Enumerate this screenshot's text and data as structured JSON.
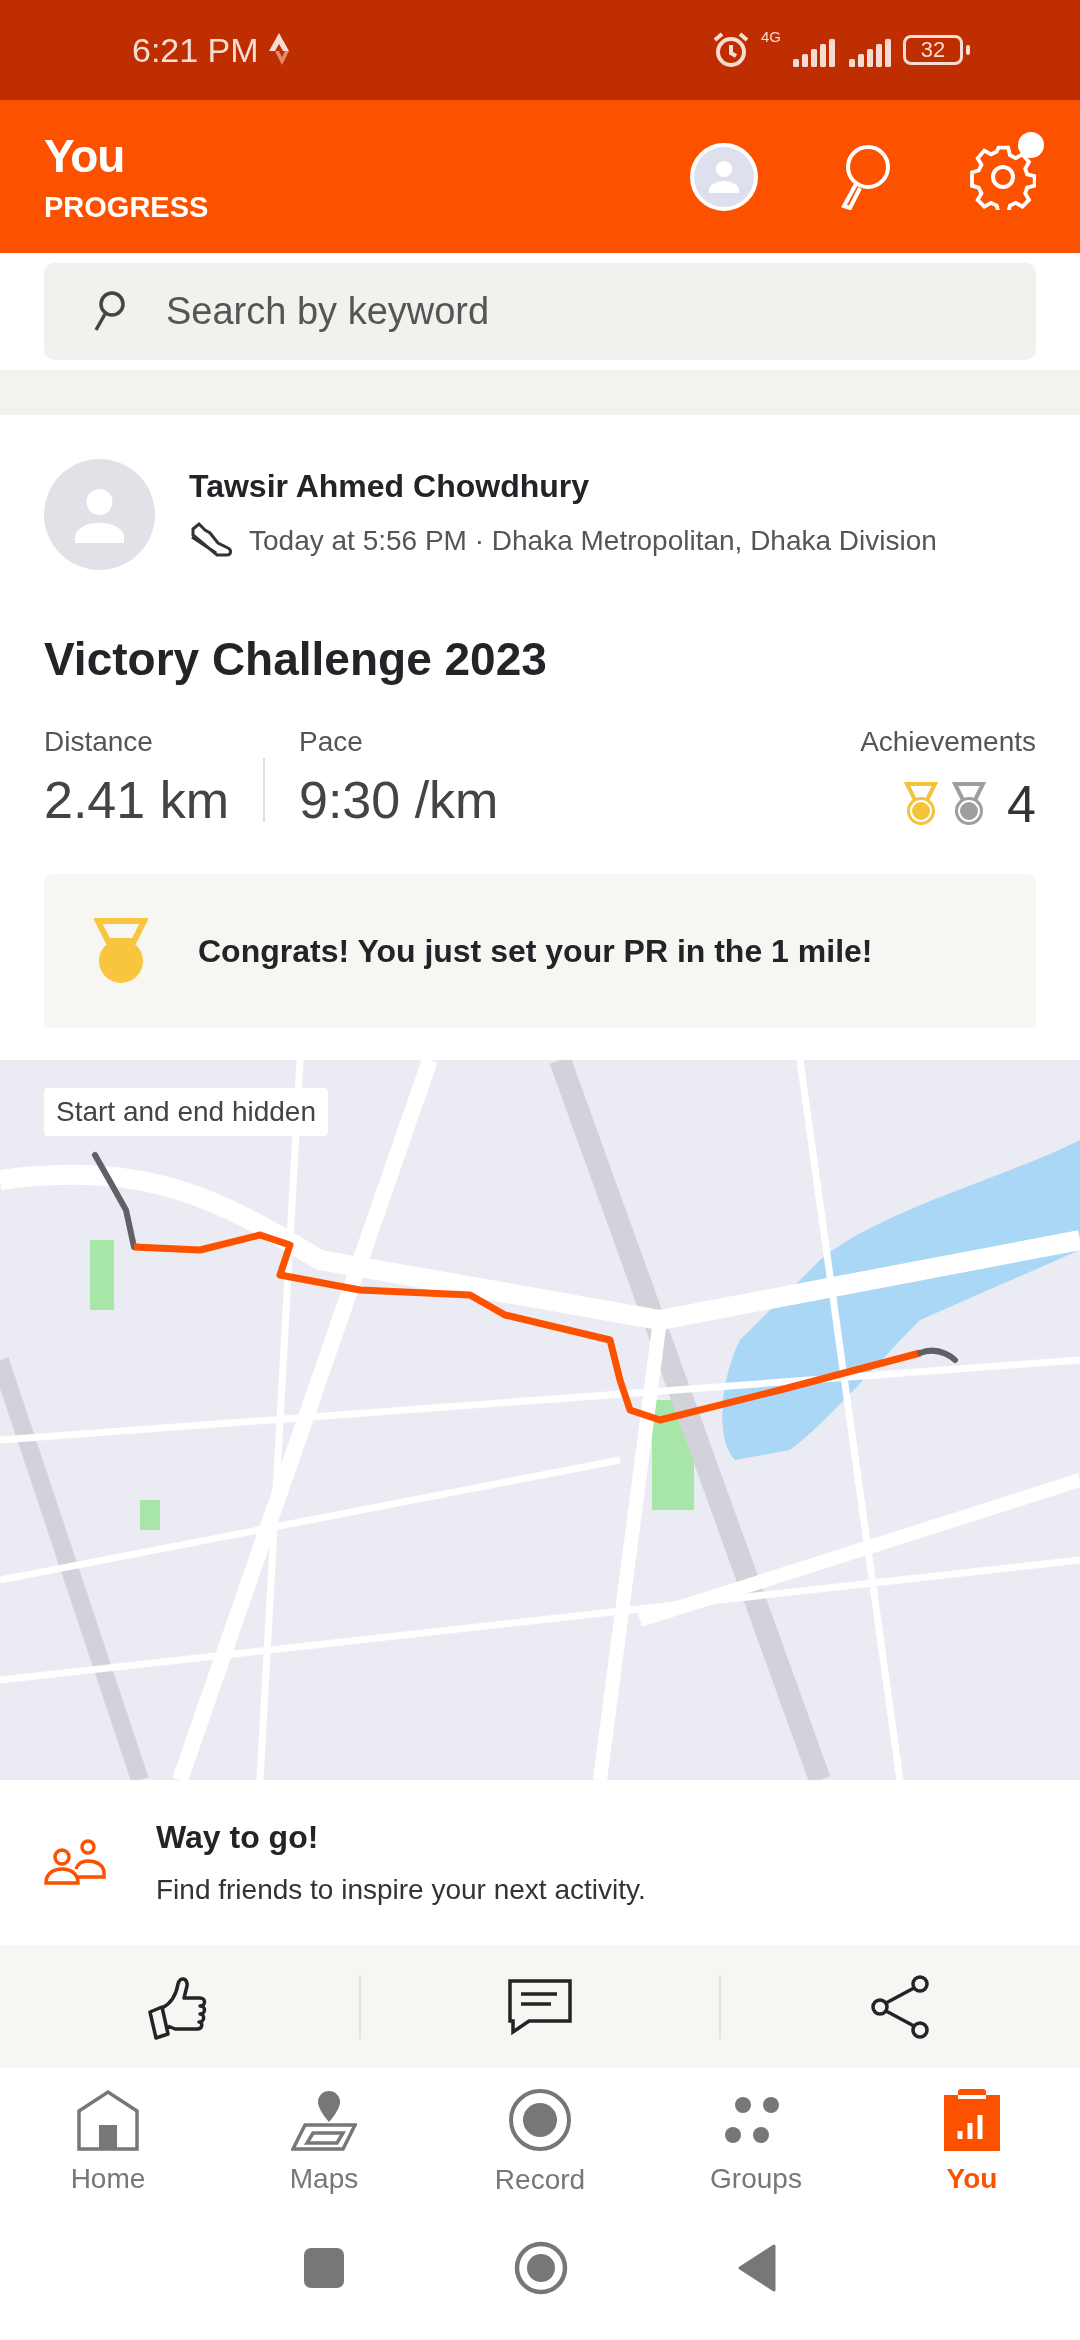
{
  "status_bar": {
    "time": "6:21 PM",
    "network": "4G",
    "battery": "32"
  },
  "header": {
    "title": "You",
    "subtitle": "PROGRESS",
    "settings_badge": true
  },
  "search": {
    "placeholder": "Search by keyword"
  },
  "activity": {
    "athlete": "Tawsir Ahmed Chowdhury",
    "meta": "Today at 5:56 PM · Dhaka Metropolitan, Dhaka Division",
    "title": "Victory Challenge 2023",
    "stats": [
      {
        "label": "Distance",
        "value": "2.41 km"
      },
      {
        "label": "Pace",
        "value": "9:30 /km"
      }
    ],
    "achievements": {
      "label": "Achievements",
      "count": "4",
      "medals": [
        {
          "color": "#f5c33b"
        },
        {
          "color": "#9e9e9e"
        }
      ]
    },
    "pr_message": "Congrats! You just set your PR in the 1 mile!",
    "map": {
      "kind": "picture",
      "badge": "Start and end hidden"
    }
  },
  "prompt": {
    "title": "Way to go!",
    "text": "Find friends to inspire your next activity."
  },
  "tabs": [
    {
      "label": "Home",
      "kind": "home",
      "selected": false
    },
    {
      "label": "Maps",
      "kind": "maps",
      "selected": false
    },
    {
      "label": "Record",
      "kind": "record",
      "selected": false
    },
    {
      "label": "Groups",
      "kind": "groups",
      "selected": false
    },
    {
      "label": "You",
      "kind": "you",
      "selected": true
    }
  ]
}
